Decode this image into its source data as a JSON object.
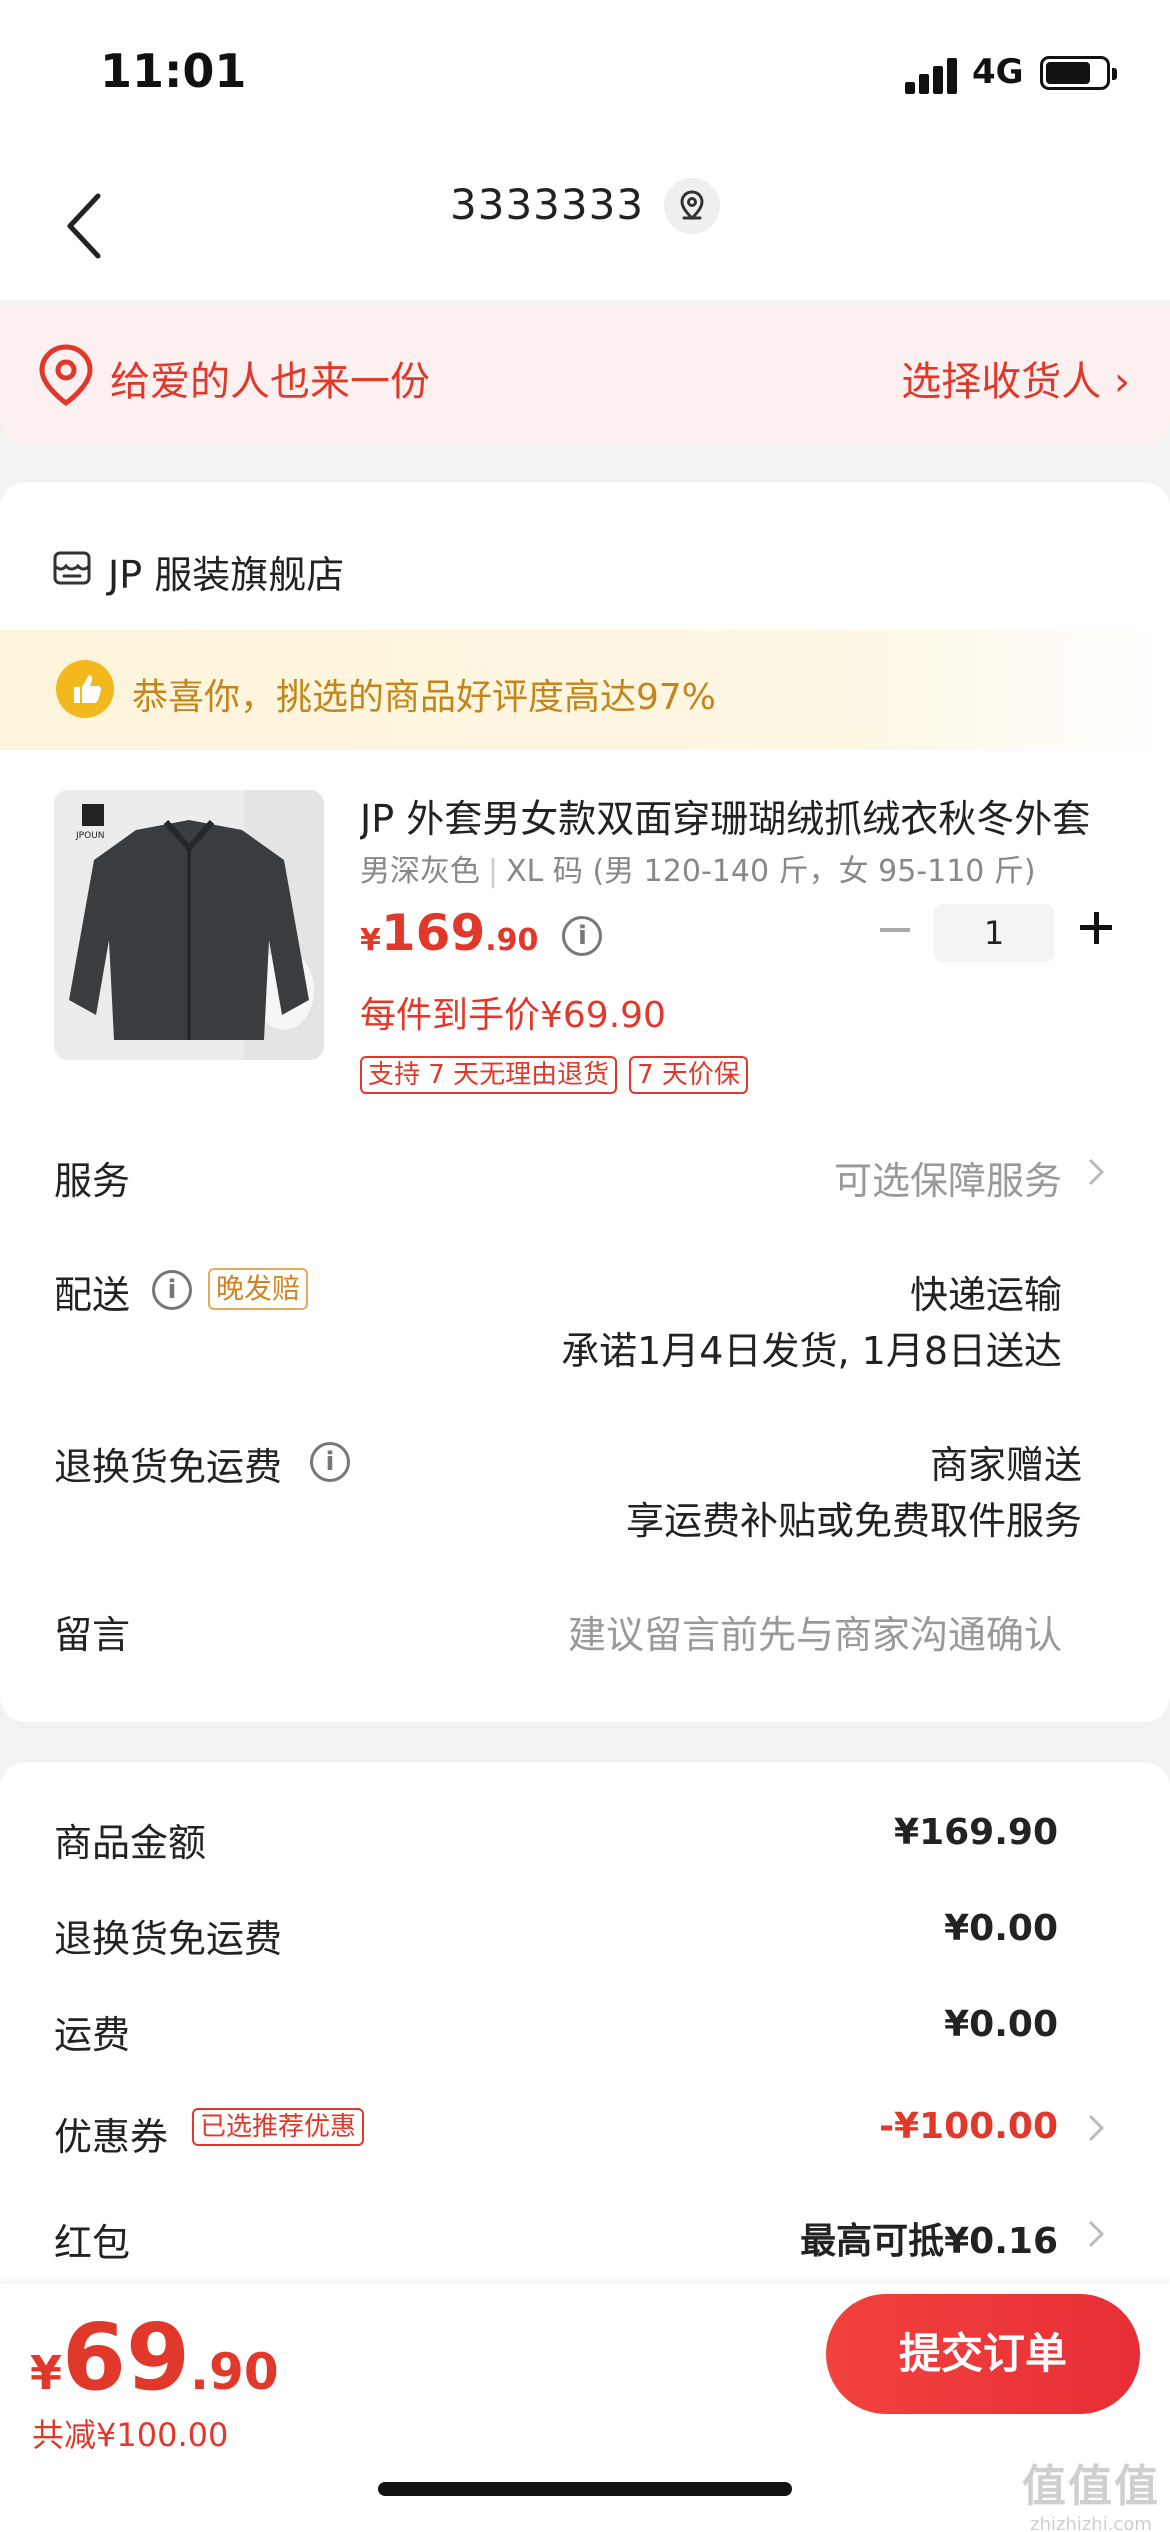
{
  "status_bar": {
    "time": "11:01",
    "network": "4G"
  },
  "nav": {
    "title": "3333333"
  },
  "gift_banner": {
    "text": "给爱的人也来一份",
    "action": "选择收货人 ›"
  },
  "shop": {
    "name": "JP 服装旗舰店"
  },
  "praise": {
    "text": "恭喜你，挑选的商品好评度高达97%"
  },
  "product": {
    "image_brand": "JPOUN",
    "title": "JP 外套男女款双面穿珊瑚绒抓绒衣秋冬外套",
    "color": "男深灰色",
    "size": "XL 码 (男 120-140 斤，女 95-110 斤)",
    "price_symbol": "¥",
    "price_int": "169",
    "price_dec": ".90",
    "quantity": "1",
    "per_item_price": "每件到手价¥69.90",
    "tags": [
      "支持 7 天无理由退货",
      "7 天价保"
    ]
  },
  "rows": {
    "service_label": "服务",
    "service_value": "可选保障服务",
    "delivery_label": "配送",
    "delivery_tag": "晚发赔",
    "delivery_method": "快递运输",
    "delivery_promise": "承诺1月4日发货, 1月8日送达",
    "return_label": "退换货免运费",
    "return_value": "商家赠送",
    "return_desc": "享运费补贴或免费取件服务",
    "message_label": "留言",
    "message_placeholder": "建议留言前先与商家沟通确认"
  },
  "summary": {
    "goods_amount_label": "商品金额",
    "goods_amount": "¥169.90",
    "return_fee_label": "退换货免运费",
    "return_fee": "¥0.00",
    "shipping_label": "运费",
    "shipping": "¥0.00",
    "coupon_label": "优惠券",
    "coupon_tag": "已选推荐优惠",
    "coupon_value": "-¥100.00",
    "redpacket_label": "红包",
    "redpacket_value": "最高可抵¥0.16"
  },
  "bottom": {
    "total_symbol": "¥",
    "total_int": "69",
    "total_dec": ".90",
    "discount": "共减¥100.00",
    "submit_label": "提交订单"
  },
  "watermark": {
    "main": "值值值",
    "sub": "zhizhizhi.com"
  }
}
